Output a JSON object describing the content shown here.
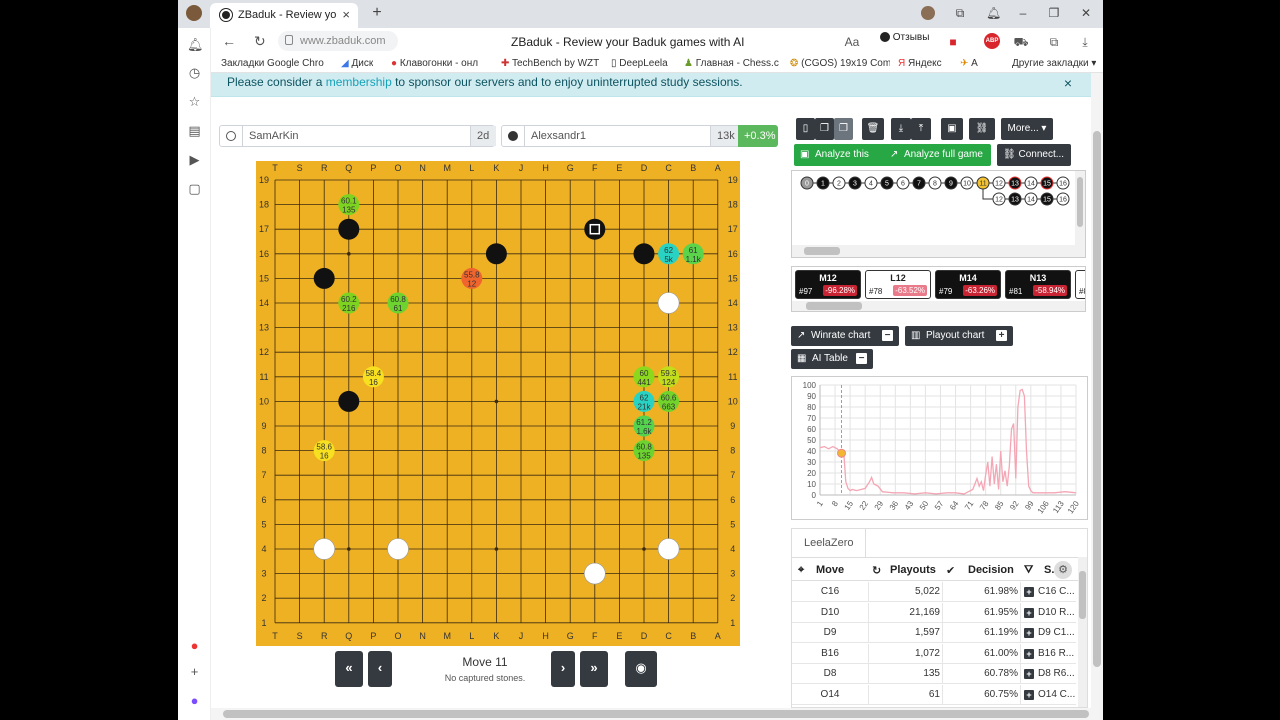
{
  "browser": {
    "tab_title": "ZBaduk - Review your Ba",
    "url": "www.zbaduk.com",
    "page_title": "ZBaduk - Review your Baduk games with AI",
    "feedback_label": "Отзывы",
    "adblock_label": "ABP",
    "bookmarks": [
      "Закладки Google Chro",
      "Диск",
      "Клавогонки - онл",
      "TechBench by WZT",
      "DeepLeela",
      "Главная - Chess.c",
      "(CGOS) 19x19 Com",
      "Яндекс",
      "А",
      "Другие закладки"
    ]
  },
  "banner": {
    "pre": "Please consider a ",
    "link": "membership",
    "post": " to sponsor our servers and to enjoy uninterrupted study sessions.",
    "close": "×"
  },
  "players": {
    "white": {
      "name": "SamArKin",
      "rank": "2d"
    },
    "black": {
      "name": "Alexsandr1",
      "rank": "13k",
      "score": "+0.3%"
    }
  },
  "board": {
    "size": 19,
    "columns": [
      "T",
      "S",
      "R",
      "Q",
      "P",
      "O",
      "N",
      "M",
      "L",
      "K",
      "J",
      "H",
      "G",
      "F",
      "E",
      "D",
      "C",
      "B",
      "A"
    ],
    "rows": [
      19,
      18,
      17,
      16,
      15,
      14,
      13,
      12,
      11,
      10,
      9,
      8,
      7,
      6,
      5,
      4,
      3,
      2,
      1
    ],
    "star_points": [
      [
        "Q",
        16
      ],
      [
        "K",
        16
      ],
      [
        "D",
        16
      ],
      [
        "Q",
        10
      ],
      [
        "K",
        10
      ],
      [
        "D",
        10
      ],
      [
        "Q",
        4
      ],
      [
        "K",
        4
      ],
      [
        "D",
        4
      ]
    ],
    "black_stones": [
      [
        "Q",
        17
      ],
      [
        "K",
        16
      ],
      [
        "D",
        16
      ],
      [
        "R",
        15
      ],
      [
        "Q",
        10
      ],
      [
        "F",
        17
      ]
    ],
    "white_stones": [
      [
        "C",
        14
      ],
      [
        "R",
        4
      ],
      [
        "O",
        4
      ],
      [
        "C",
        4
      ],
      [
        "F",
        3
      ]
    ],
    "last_move": [
      "F",
      17
    ],
    "suggestions": [
      {
        "pos": [
          "Q",
          18
        ],
        "winrate": "60.1",
        "playouts": "135",
        "color": "#7ed321"
      },
      {
        "pos": [
          "C",
          16
        ],
        "winrate": "62",
        "playouts": "5k",
        "color": "#29d3c4"
      },
      {
        "pos": [
          "B",
          16
        ],
        "winrate": "61",
        "playouts": "1.1k",
        "color": "#5bd34b"
      },
      {
        "pos": [
          "L",
          15
        ],
        "winrate": "55.8",
        "playouts": "12",
        "color": "#f0652d"
      },
      {
        "pos": [
          "Q",
          14
        ],
        "winrate": "60.2",
        "playouts": "216",
        "color": "#7ed321"
      },
      {
        "pos": [
          "O",
          14
        ],
        "winrate": "60.8",
        "playouts": "61",
        "color": "#6cd32f"
      },
      {
        "pos": [
          "P",
          11
        ],
        "winrate": "58.4",
        "playouts": "16",
        "color": "#f7e020"
      },
      {
        "pos": [
          "D",
          11
        ],
        "winrate": "60",
        "playouts": "441",
        "color": "#8cd81c"
      },
      {
        "pos": [
          "C",
          11
        ],
        "winrate": "59.3",
        "playouts": "124",
        "color": "#c2dd1a"
      },
      {
        "pos": [
          "D",
          10
        ],
        "winrate": "62",
        "playouts": "21k",
        "color": "#29d3c4"
      },
      {
        "pos": [
          "C",
          10
        ],
        "winrate": "60.6",
        "playouts": "663",
        "color": "#72d42a"
      },
      {
        "pos": [
          "D",
          9
        ],
        "winrate": "61.2",
        "playouts": "1.6k",
        "color": "#54d34f"
      },
      {
        "pos": [
          "R",
          8
        ],
        "winrate": "58.6",
        "playouts": "16",
        "color": "#f7e020"
      },
      {
        "pos": [
          "D",
          8
        ],
        "winrate": "60.8",
        "playouts": "135",
        "color": "#6cd32f"
      }
    ]
  },
  "controls": {
    "first": "«",
    "prev": "‹",
    "next": "›",
    "last": "»",
    "move_label": "Move 11",
    "captures": "No captured stones."
  },
  "toolbar": {
    "analyze_this": "Analyze this",
    "analyze_full": "Analyze full game",
    "connect": "Connect...",
    "more": "More..."
  },
  "tree": {
    "main": [
      {
        "n": "0",
        "c": "gray"
      },
      {
        "n": "1",
        "c": "b"
      },
      {
        "n": "2",
        "c": "w"
      },
      {
        "n": "3",
        "c": "b"
      },
      {
        "n": "4",
        "c": "w"
      },
      {
        "n": "5",
        "c": "b"
      },
      {
        "n": "6",
        "c": "w"
      },
      {
        "n": "7",
        "c": "b"
      },
      {
        "n": "8",
        "c": "w"
      },
      {
        "n": "9",
        "c": "b"
      },
      {
        "n": "10",
        "c": "w"
      },
      {
        "n": "11",
        "c": "y"
      },
      {
        "n": "12",
        "c": "w"
      },
      {
        "n": "13",
        "c": "rb"
      },
      {
        "n": "14",
        "c": "w"
      },
      {
        "n": "15",
        "c": "rb"
      },
      {
        "n": "16",
        "c": "w"
      }
    ],
    "branch": [
      {
        "n": "12",
        "c": "w"
      },
      {
        "n": "13",
        "c": "b"
      },
      {
        "n": "14",
        "c": "w"
      },
      {
        "n": "15",
        "c": "b"
      },
      {
        "n": "16",
        "c": "w"
      }
    ]
  },
  "mistakes": [
    {
      "move": "M12",
      "num": "#97",
      "pct": "-96.28%",
      "dark": true
    },
    {
      "move": "L12",
      "num": "#78",
      "pct": "-63.52%",
      "dark": false
    },
    {
      "move": "M14",
      "num": "#79",
      "pct": "-63.26%",
      "dark": true
    },
    {
      "move": "N13",
      "num": "#81",
      "pct": "-58.94%",
      "dark": true
    },
    {
      "move": "",
      "num": "#8",
      "pct": "",
      "dark": false
    }
  ],
  "sections": {
    "winrate": "Winrate chart",
    "playout": "Playout chart",
    "aitable": "AI Table"
  },
  "chart_data": {
    "type": "line",
    "title": "",
    "xlabel": "",
    "ylabel": "",
    "ylim": [
      0,
      100
    ],
    "xlim": [
      1,
      120
    ],
    "yticks": [
      0,
      10,
      20,
      30,
      40,
      50,
      60,
      70,
      80,
      90,
      100
    ],
    "xticks": [
      1,
      8,
      15,
      22,
      29,
      36,
      43,
      50,
      57,
      64,
      71,
      78,
      85,
      92,
      99,
      106,
      113,
      120
    ],
    "current_move": 11,
    "current_value": 38,
    "series": [
      {
        "color": "#f4a6b4",
        "x": [
          1,
          3,
          5,
          7,
          9,
          11,
          12,
          13,
          14,
          15,
          16,
          18,
          20,
          22,
          24,
          25,
          26,
          28,
          30,
          35,
          40,
          45,
          50,
          55,
          60,
          64,
          68,
          70,
          72,
          73,
          74,
          75,
          76,
          77,
          78,
          79,
          80,
          81,
          82,
          83,
          84,
          85,
          86,
          87,
          88,
          89,
          90,
          91,
          92,
          93,
          94,
          95,
          96,
          97,
          98,
          99,
          100,
          102,
          105,
          110,
          115,
          120
        ],
        "values": [
          43,
          44,
          42,
          44,
          42,
          38,
          40,
          12,
          6,
          4,
          5,
          4,
          5,
          6,
          12,
          16,
          10,
          8,
          3,
          2,
          2,
          1,
          2,
          1,
          2,
          2,
          1,
          3,
          5,
          10,
          15,
          8,
          12,
          4,
          18,
          30,
          8,
          35,
          10,
          28,
          5,
          40,
          12,
          22,
          8,
          26,
          60,
          65,
          15,
          80,
          95,
          96,
          90,
          40,
          8,
          4,
          2,
          2,
          2,
          2,
          3,
          2
        ]
      }
    ]
  },
  "ai_table": {
    "engine": "LeelaZero",
    "headers": {
      "move": "Move",
      "playouts": "Playouts",
      "decision": "Decision",
      "seq": "S..."
    },
    "rows": [
      {
        "move": "C16",
        "playouts": "5,022",
        "decision": "61.98%",
        "seq": "C16 C..."
      },
      {
        "move": "D10",
        "playouts": "21,169",
        "decision": "61.95%",
        "seq": "D10 R..."
      },
      {
        "move": "D9",
        "playouts": "1,597",
        "decision": "61.19%",
        "seq": "D9 C1..."
      },
      {
        "move": "B16",
        "playouts": "1,072",
        "decision": "61.00%",
        "seq": "B16 R..."
      },
      {
        "move": "D8",
        "playouts": "135",
        "decision": "60.78%",
        "seq": "D8 R6..."
      },
      {
        "move": "O14",
        "playouts": "61",
        "decision": "60.75%",
        "seq": "O14 C..."
      }
    ]
  }
}
